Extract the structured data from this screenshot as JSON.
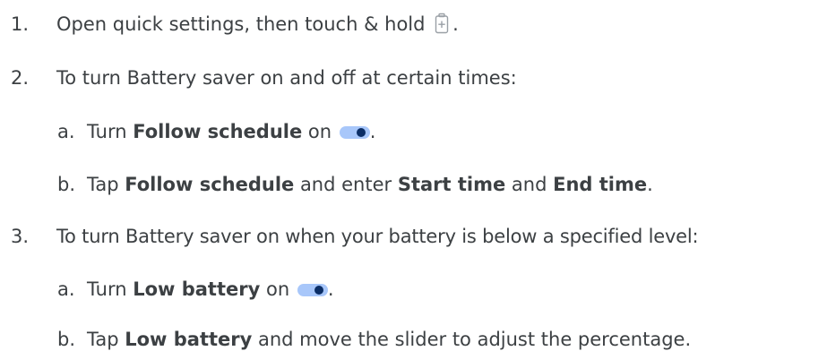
{
  "steps": [
    {
      "num": "1.",
      "parts": {
        "a": "Open quick settings, then touch & hold ",
        "b": "."
      }
    },
    {
      "num": "2.",
      "parts": {
        "a": "To turn Battery saver on and off at certain times:"
      }
    },
    {
      "num": "a.",
      "parts": {
        "a": "Turn ",
        "b": "Follow schedule",
        "c": " on ",
        "d": "."
      }
    },
    {
      "num": "b.",
      "parts": {
        "a": "Tap ",
        "b": "Follow schedule",
        "c": " and enter ",
        "d": "Start time",
        "e": " and ",
        "f": "End time",
        "g": "."
      }
    },
    {
      "num": "3.",
      "parts": {
        "a": "To turn Battery saver on when your battery is below a specified level:"
      }
    },
    {
      "num": "a.",
      "parts": {
        "a": "Turn ",
        "b": "Low battery",
        "c": " on ",
        "d": "."
      }
    },
    {
      "num": "b.",
      "parts": {
        "a": "Tap ",
        "b": "Low battery",
        "c": " and move the slider to adjust the percentage."
      }
    }
  ],
  "icons": {
    "battery_saver": "battery-saver-icon",
    "toggle_on": "toggle-on-icon"
  },
  "colors": {
    "text": "#3c4043",
    "toggle_track": "#a8c7fa",
    "toggle_thumb": "#0b2e66",
    "icon_stroke": "#9aa0a6"
  }
}
